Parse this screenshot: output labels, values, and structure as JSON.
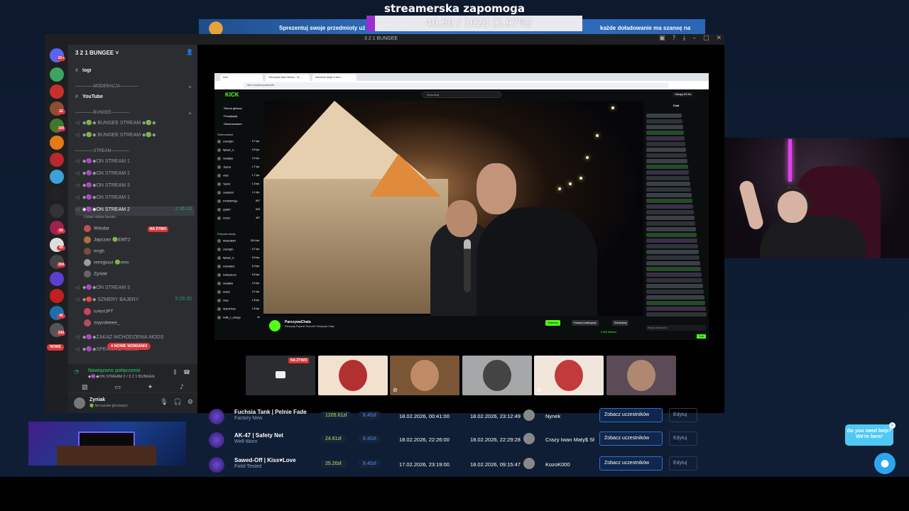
{
  "overlay": {
    "title": "streamerska zapomoga",
    "goal_progress": "40.50 / 1020 (3.97%)",
    "goal_fraction": 0.0397
  },
  "promo": {
    "text_left": "Sprezentuj swoje przedmioty uż",
    "text_right": "każde doładowanie ma szansę na"
  },
  "discord": {
    "window_title": "3 2 1 BUNGEE",
    "server_name": "3 2 1 BUNGEE ˅",
    "guild_badges": [
      "1K+",
      "32",
      "100",
      "65",
      "49",
      "304",
      "45",
      "342"
    ],
    "channels": [
      {
        "label": "logi",
        "icon": "#",
        "bold": true
      },
      {
        "label": "──────MODERACJA──────",
        "icon": "",
        "category": true
      },
      {
        "label": "YouTube",
        "icon": "#",
        "bold": true
      },
      {
        "label": "──────BUNGEE──────",
        "icon": "",
        "category": true
      },
      {
        "label": "◆🟢◆ BUNGEE STREAM ◆🟢◆",
        "icon": "🔊"
      },
      {
        "label": "◆🟢◆ BUNGEE STREAM ◆🟢◆",
        "icon": "🔊"
      },
      {
        "label": "──────STREAM──────",
        "icon": "",
        "category": true
      },
      {
        "label": "◆🟣◆ON STREAM 1",
        "icon": "🔊"
      },
      {
        "label": "◆🟣◆ON STREAM 2",
        "icon": "🔊"
      },
      {
        "label": "◆🟣◆ON STREAM 3",
        "icon": "🔊"
      },
      {
        "label": "◆🟣◆ON STREAM 1",
        "icon": "🔊"
      },
      {
        "label": "◆🟣◆ON STREAM 2",
        "icon": "🔊",
        "active": true,
        "time": "2:36:23"
      }
    ],
    "channel_status": "Ustaw status kanału",
    "members": [
      {
        "name": "Wilodar",
        "live": "NA ŻYWO"
      },
      {
        "name": "Japczan 🟢EMT2"
      },
      {
        "name": "mrgh"
      },
      {
        "name": "remigiusz 🟢rero"
      },
      {
        "name": "Zyniak"
      }
    ],
    "channels_bottom": [
      {
        "label": "◆🟣◆ON STREAM 3",
        "icon": "🔊"
      },
      {
        "label": "◆🔴◆ SZMERY BAJERY",
        "icon": "🔊",
        "time": "5:26:20"
      }
    ],
    "members_bottom": [
      {
        "name": "isAmUPT"
      },
      {
        "name": "zwyroleeee_"
      }
    ],
    "channels_tail": [
      {
        "label": "◆🟣◆ZAKAZ WCHODZENIA MODS",
        "icon": "🔊"
      },
      {
        "label": "◆🟣◆SPEAKING NEWS",
        "icon": "🔊"
      }
    ],
    "new_mentions": "4 NOWE WZMIANKI",
    "new_badge": "NOWE",
    "voice_connected": "Nawiązano połączenie",
    "voice_channel": "◆🟣◆ON STREAM 2 / 3 2 1 BUNGEE",
    "user_name": "Zyniak",
    "user_status": "🟢 Na kanale głosowym"
  },
  "kick": {
    "tabs": [
      "Kick",
      "ParszywaChata Stream - 21...",
      "Darmowe Akcje w sieci..."
    ],
    "url": "kick.com/parszywachata",
    "logo": "KICK",
    "search_placeholder": "Wyszukaj",
    "login": "Zaloguj KICKa",
    "nav": [
      "Strona główna",
      "Przeglądaj",
      "Obserwowane"
    ],
    "following_header": "Obserwowane",
    "following": [
      {
        "name": "smerfgtm",
        "n": "6,7 tys."
      },
      {
        "name": "flyback_d...",
        "n": "6,9 tys."
      },
      {
        "name": "mediakia",
        "n": "2,4 tys."
      },
      {
        "name": "Japcza",
        "n": "1,7 tys."
      },
      {
        "name": "ninar",
        "n": "1,7 tys."
      },
      {
        "name": "Taxmir",
        "n": "1,3 tys."
      },
      {
        "name": "cassiebot",
        "n": "1,1 tys."
      },
      {
        "name": "STORKPrtgo",
        "n": "847"
      },
      {
        "name": "pykall7",
        "n": "623"
      },
      {
        "name": "mrofor",
        "n": "467"
      }
    ],
    "recommended_header": "Polecane kanały",
    "recommended": [
      {
        "name": "Mhabukb87",
        "n": "28,4 tys."
      },
      {
        "name": "smerfgtm",
        "n": "6,7 tys."
      },
      {
        "name": "flyback_d...",
        "n": "6,9 tys."
      },
      {
        "name": "entertaiion",
        "n": "6,3 tys."
      },
      {
        "name": "SzikanaLive",
        "n": "5,4 tys."
      },
      {
        "name": "mediakia",
        "n": "2,4 tys."
      },
      {
        "name": "Andes",
        "n": "2,1 tys."
      },
      {
        "name": "ninar",
        "n": "1,8 tys."
      },
      {
        "name": "NOKNTEM",
        "n": "1,6 tys."
      },
      {
        "name": "koliik_s_zadego",
        "n": "41"
      }
    ],
    "channel": "ParszywaChata",
    "stream_title": "Parszywy Pojazd!! Gnusnik Parszywej Chaty",
    "follow_btn": "Obserwuj",
    "gift_btn": "Podaruj subskrypcje",
    "sub_btn": "Subskrybuj",
    "chat_header": "Czat",
    "chat_placeholder": "Wyślij wiadomość",
    "chat_send": "Czat",
    "viewers": "6 462 Widzów"
  },
  "tiles": [
    {
      "live": "NA ŻYWO",
      "color": "#2a2c30"
    },
    {
      "color": "#f2e1cf"
    },
    {
      "color": "#7a5536"
    },
    {
      "color": "#a6a7a9"
    },
    {
      "color": "#f0e6dc"
    },
    {
      "color": "#5a4b57"
    }
  ],
  "table": {
    "rows": [
      {
        "name": "Fuchsia Tank | Pelnie Fade",
        "wear": "Factory New",
        "price": "1205.61zł",
        "price2": "8.40zł",
        "date1": "18.02.2026, 00:41:00",
        "date2": "18.02.2026, 23:12:49",
        "winner": "Nynek",
        "view_btn": "Zobacz uczestników",
        "edit_btn": "Edytuj"
      },
      {
        "name": "AK-47 | Safety Net",
        "wear": "Well-Worn",
        "price": "24.61zł",
        "price2": "8.40zł",
        "date1": "18.02.2026, 22:26:00",
        "date2": "18.02.2026, 22:29:28",
        "winner": "Crazy Iwan Maty$ Sł",
        "view_btn": "Zobacz uczestników",
        "edit_btn": "Edytuj"
      },
      {
        "name": "Sawed-Off | Kiss♥Love",
        "wear": "Field-Tested",
        "price": "25.20zł",
        "price2": "8.40zł",
        "date1": "17.02.2026, 23:19:00",
        "date2": "18.02.2026, 09:15:47",
        "winner": "KozoK000",
        "view_btn": "Zobacz uczestników",
        "edit_btn": "Edytuj"
      }
    ]
  },
  "help": {
    "text": "Do you need help? We're here!",
    "close": "×",
    "fab_icon": "chat-bubble-icon"
  },
  "colors": {
    "kick_green": "#53fc18",
    "discord_red": "#da373c",
    "discord_green": "#23a55a",
    "site_bg": "#0f1e35"
  }
}
